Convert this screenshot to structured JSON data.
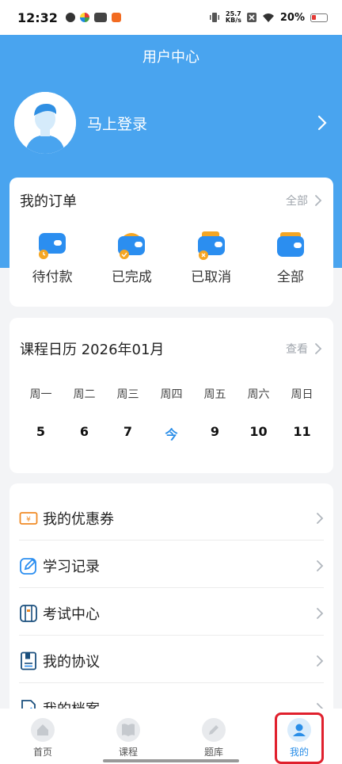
{
  "status_bar": {
    "time": "12:32",
    "net_speed_value": "25.7",
    "net_speed_unit": "KB/s",
    "battery_percent": "20%"
  },
  "header": {
    "title": "用户中心"
  },
  "profile": {
    "login_label": "马上登录"
  },
  "orders": {
    "title": "我的订单",
    "more_label": "全部",
    "items": [
      {
        "label": "待付款",
        "icon": "wallet-pending-icon"
      },
      {
        "label": "已完成",
        "icon": "wallet-done-icon"
      },
      {
        "label": "已取消",
        "icon": "wallet-cancel-icon"
      },
      {
        "label": "全部",
        "icon": "wallet-all-icon"
      }
    ]
  },
  "calendar": {
    "title": "课程日历 2026年01月",
    "more_label": "查看",
    "weekdays": [
      "周一",
      "周二",
      "周三",
      "周四",
      "周五",
      "周六",
      "周日"
    ],
    "days": [
      "5",
      "6",
      "7",
      "今",
      "9",
      "10",
      "11"
    ]
  },
  "menu": {
    "items": [
      {
        "label": "我的优惠券",
        "icon": "coupon-icon"
      },
      {
        "label": "学习记录",
        "icon": "edit-icon"
      },
      {
        "label": "考试中心",
        "icon": "exam-icon"
      },
      {
        "label": "我的协议",
        "icon": "agreement-icon"
      },
      {
        "label": "我的档案",
        "icon": "archive-icon"
      }
    ]
  },
  "tabbar": {
    "items": [
      {
        "label": "首页",
        "icon": "home-icon"
      },
      {
        "label": "课程",
        "icon": "book-icon"
      },
      {
        "label": "题库",
        "icon": "pencil-icon"
      },
      {
        "label": "我的",
        "icon": "user-icon"
      }
    ]
  },
  "colors": {
    "brand": "#49a4ef",
    "accent": "#2a8ee8",
    "highlight": "#e0202d"
  }
}
